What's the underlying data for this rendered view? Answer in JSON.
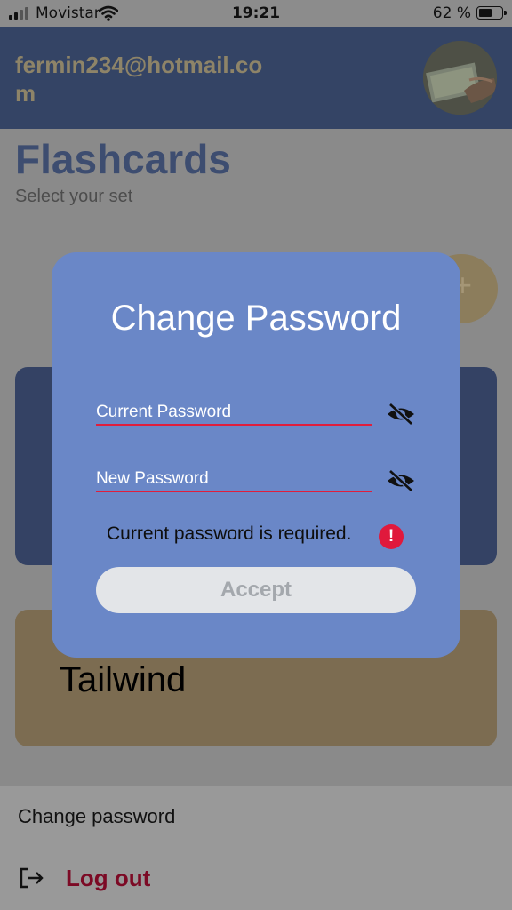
{
  "status_bar": {
    "carrier": "Movistar",
    "time": "19:21",
    "battery_percent": "62 %",
    "battery_level": 0.62
  },
  "header": {
    "email": "fermin234@hotmail.com"
  },
  "page": {
    "title": "Flashcards",
    "subtitle": "Select your set",
    "add_button": "+",
    "cards": [
      {
        "title": "",
        "color": "#344264"
      },
      {
        "title": "Tailwind",
        "color": "#7c6c51"
      }
    ]
  },
  "modal": {
    "title": "Change Password",
    "current_password_placeholder": "Current Password",
    "new_password_placeholder": "New Password",
    "error_message": "Current password is required.",
    "error_icon": "!",
    "accept_label": "Accept",
    "background_color": "#6a87c7",
    "error_color": "#e0193c"
  },
  "bottom_sheet": {
    "change_password_label": "Change password",
    "logout_label": "Log out",
    "logout_color": "#7c0a25"
  },
  "icons": {
    "signal": "signal-bars-icon",
    "wifi": "wifi-icon",
    "battery": "battery-icon",
    "eye_off": "eye-off-icon",
    "error": "exclamation-icon",
    "logout": "logout-icon"
  }
}
